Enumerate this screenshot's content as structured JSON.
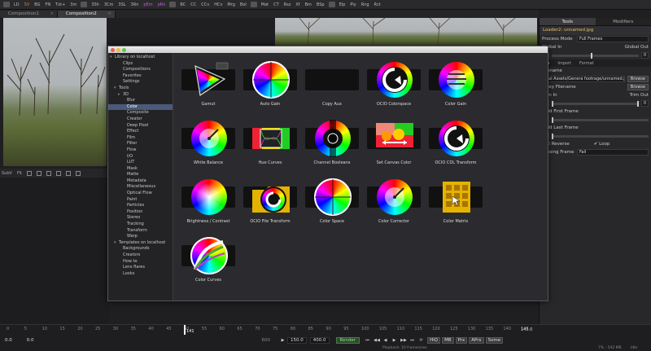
{
  "toolbar": {
    "items": [
      "LD",
      "SV",
      "BG",
      "FN",
      "Txt+",
      "3m",
      "3Sh",
      "3Cm",
      "3SL",
      "3Rn",
      "pEm",
      "pRn",
      "BC",
      "CC",
      "CCv",
      "HCv",
      "Mrg",
      "Bol",
      "Mat",
      "CT",
      "Rsz",
      "Xf",
      "Bm",
      "BSp",
      "Elp",
      "Ply",
      "Rng",
      "Rct"
    ]
  },
  "tabs": [
    {
      "label": "Composition1",
      "active": false
    },
    {
      "label": "Composition2",
      "active": true
    }
  ],
  "viewer_footer": {
    "zoom_label": "SubV",
    "fit_label": "Fit"
  },
  "inspector": {
    "tabs": [
      "Tools",
      "Modifiers"
    ],
    "node_title": "Loader2: unnamed.jpg",
    "process_mode_label": "Process Mode",
    "process_mode_value": "Full Frames",
    "global_in_label": "Global In",
    "global_out_label": "Global Out",
    "global_in_value": "0",
    "global_mid_value": "1",
    "global_out_value": "0",
    "subtabs": [
      "File",
      "Import",
      "Format"
    ],
    "filename_label": "Filename",
    "filename_value": "eral Assets/Genera footrage/unnamed.jpg",
    "browse_label": "Browse",
    "proxy_filename_label": "Proxy Filename",
    "trim_in_label": "Trim In",
    "trim_out_label": "Trim Out",
    "trim_in_value": "0",
    "trim_mid_value": "1",
    "trim_out_value": "0",
    "hold_first_label": "Hold First Frame",
    "hold_first_value": "0",
    "hold_last_label": "Hold Last Frame",
    "hold_last_value": "0",
    "reverse_label": "Reverse",
    "loop_label": "Loop",
    "missing_frames_label": "Missing Frame",
    "missing_frames_value": "Fail"
  },
  "library": {
    "tree": [
      {
        "label": "Library on localhost",
        "indent": 0,
        "arrow": "▾"
      },
      {
        "label": "Clips",
        "indent": 2
      },
      {
        "label": "Compositions",
        "indent": 2
      },
      {
        "label": "Favorites",
        "indent": 2
      },
      {
        "label": "Settings",
        "indent": 2
      },
      {
        "label": "Tools",
        "indent": 1,
        "arrow": "▾"
      },
      {
        "label": "3D",
        "indent": 2,
        "arrow": "▸"
      },
      {
        "label": "Blur",
        "indent": 3
      },
      {
        "label": "Color",
        "indent": 3,
        "selected": true
      },
      {
        "label": "Composite",
        "indent": 3
      },
      {
        "label": "Creator",
        "indent": 3
      },
      {
        "label": "Deep Pixel",
        "indent": 3
      },
      {
        "label": "Effect",
        "indent": 3
      },
      {
        "label": "Film",
        "indent": 3
      },
      {
        "label": "Filter",
        "indent": 3
      },
      {
        "label": "Flow",
        "indent": 3
      },
      {
        "label": "I/O",
        "indent": 3
      },
      {
        "label": "LUT",
        "indent": 3
      },
      {
        "label": "Mask",
        "indent": 3
      },
      {
        "label": "Matte",
        "indent": 3
      },
      {
        "label": "Metadata",
        "indent": 3
      },
      {
        "label": "Miscellaneous",
        "indent": 3
      },
      {
        "label": "Optical Flow",
        "indent": 3
      },
      {
        "label": "Paint",
        "indent": 3
      },
      {
        "label": "Particles",
        "indent": 3
      },
      {
        "label": "Position",
        "indent": 3
      },
      {
        "label": "Stereo",
        "indent": 3
      },
      {
        "label": "Tracking",
        "indent": 3
      },
      {
        "label": "Transform",
        "indent": 3
      },
      {
        "label": "Warp",
        "indent": 3
      },
      {
        "label": "Templates on localhost",
        "indent": 1,
        "arrow": "▾"
      },
      {
        "label": "Backgrounds",
        "indent": 2
      },
      {
        "label": "Creators",
        "indent": 2
      },
      {
        "label": "How to",
        "indent": 2
      },
      {
        "label": "Lens flares",
        "indent": 2
      },
      {
        "label": "Looks",
        "indent": 2
      }
    ],
    "tools": [
      {
        "label": "Gamut",
        "icon": "gamut-icon"
      },
      {
        "label": "Auto Gain",
        "icon": "auto-gain-icon"
      },
      {
        "label": "Copy Aux",
        "icon": "copy-aux-icon"
      },
      {
        "label": "OCIO Colorspace",
        "icon": "ocio-colorspace-icon"
      },
      {
        "label": "Color Gain",
        "icon": "color-gain-icon"
      },
      {
        "label": "White Balance",
        "icon": "white-balance-icon"
      },
      {
        "label": "Hue Curves",
        "icon": "hue-curves-icon"
      },
      {
        "label": "Channel Booleans",
        "icon": "channel-booleans-icon"
      },
      {
        "label": "Set Canvas Color",
        "icon": "set-canvas-color-icon"
      },
      {
        "label": "OCIO CDL Transform",
        "icon": "ocio-cdl-icon"
      },
      {
        "label": "Brightness / Contrast",
        "icon": "brightness-contrast-icon"
      },
      {
        "label": "OCIO File Transform",
        "icon": "ocio-file-icon"
      },
      {
        "label": "Color Space",
        "icon": "color-space-icon"
      },
      {
        "label": "Color Corrector",
        "icon": "color-corrector-icon"
      },
      {
        "label": "Color Matrix",
        "icon": "color-matrix-icon"
      },
      {
        "label": "Color Curves",
        "icon": "color-curves-icon"
      }
    ]
  },
  "timeline": {
    "ruler_ticks": [
      "0",
      "5",
      "10",
      "15",
      "20",
      "25",
      "30",
      "35",
      "40",
      "45",
      "50",
      "55",
      "60",
      "65",
      "70",
      "75",
      "80",
      "85",
      "90",
      "95",
      "100",
      "105",
      "110",
      "115",
      "120",
      "125",
      "130",
      "135",
      "140",
      "145"
    ],
    "current_frame": "141",
    "end_frame": "145.0",
    "start_value": "0.0",
    "start_value2": "0.0",
    "mid_value": "600",
    "render_start": "150.0",
    "render_end": "400.0",
    "render_label": "Render",
    "hiq_label": "HiQ",
    "mb_label": "MB",
    "prx_label": "Prx",
    "aprx_label": "APrx",
    "some_label": "Some",
    "playback_status": "Playback: 10 frames/sec",
    "memory_status": "7% - 542 MB",
    "idle_status": "Idle"
  }
}
